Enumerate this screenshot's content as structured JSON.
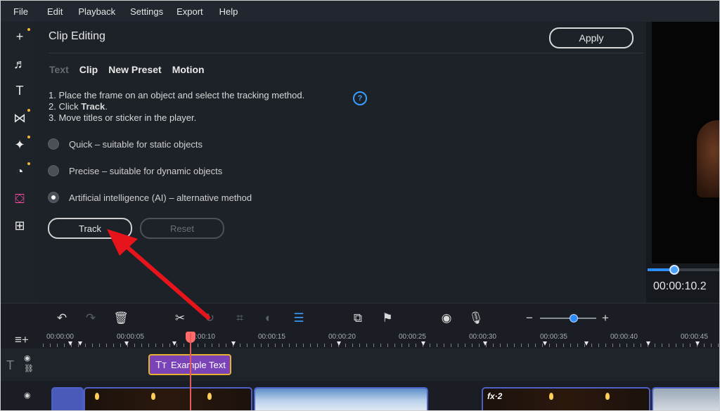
{
  "menu": [
    "File",
    "Edit",
    "Playback",
    "Settings",
    "Export",
    "Help"
  ],
  "left_tools": [
    "add-icon",
    "music-icon",
    "text-icon",
    "transition-icon",
    "magic-wand-icon",
    "sticker-icon",
    "clip-editing-icon",
    "apps-icon"
  ],
  "panel": {
    "title": "Clip Editing",
    "apply_label": "Apply",
    "tabs": [
      "Text",
      "Clip",
      "New Preset",
      "Motion"
    ],
    "instructions": {
      "line1": "1. Place the frame on an object and select the tracking method.",
      "line2_prefix": "2. Click ",
      "line2_bold": "Track",
      "line2_suffix": ".",
      "line3": "3. Move titles or sticker in the player."
    },
    "help": "?",
    "options": [
      "Quick – suitable for static objects",
      "Precise – suitable for dynamic objects",
      "Artificial intelligence (AI) – alternative method"
    ],
    "selected_option": 2,
    "track_label": "Track",
    "reset_label": "Reset"
  },
  "player": {
    "timecode": "00:00:10.2"
  },
  "timeline": {
    "ruler": [
      "00:00:00",
      "00:00:05",
      "00:00:10",
      "00:00:15",
      "00:00:20",
      "00:00:25",
      "00:00:30",
      "00:00:35",
      "00:00:40",
      "00:00:45"
    ],
    "text_clip": "Example Text",
    "fx_label": "fx·2"
  },
  "colors": {
    "accent": "#2f8cff",
    "playhead": "#e85a5a",
    "text_clip": "#7a44b8",
    "annotation": "#e8141c"
  }
}
